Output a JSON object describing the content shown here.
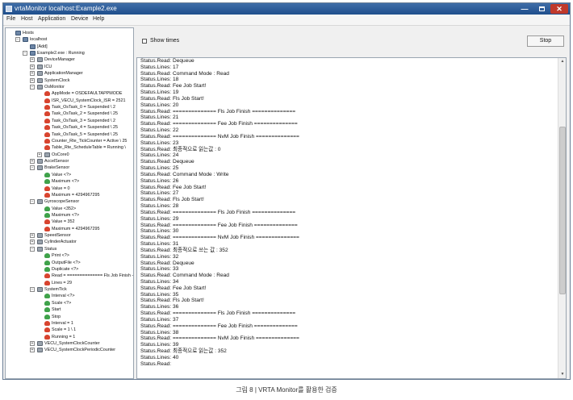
{
  "window": {
    "title": "vrtaMonitor localhost:Example2.exe",
    "min_glyph": "—",
    "close_glyph": "✕"
  },
  "menu": [
    "File",
    "Host",
    "Application",
    "Device",
    "Help"
  ],
  "tree": {
    "rows": [
      {
        "label": "Hosts",
        "depth": 0,
        "icon": "host",
        "toggle": ""
      },
      {
        "label": "localhost",
        "depth": 1,
        "icon": "host",
        "toggle": "−"
      },
      {
        "label": "[Add]",
        "depth": 2,
        "icon": "host",
        "toggle": ""
      },
      {
        "label": "Example2.exe : Running",
        "depth": 2,
        "icon": "app",
        "toggle": "−"
      },
      {
        "label": "DeviceManager",
        "depth": 3,
        "icon": "folder",
        "toggle": "+"
      },
      {
        "label": "ICU",
        "depth": 3,
        "icon": "folder",
        "toggle": "+"
      },
      {
        "label": "ApplicationManager",
        "depth": 3,
        "icon": "folder",
        "toggle": "+"
      },
      {
        "label": "SystemClock",
        "depth": 3,
        "icon": "folder",
        "toggle": "+"
      },
      {
        "label": "OsMonitor",
        "depth": 3,
        "icon": "folder",
        "toggle": "−"
      },
      {
        "label": "AppMode = OSDEFAULTAPPMODE",
        "depth": 4,
        "icon": "person-red",
        "toggle": ""
      },
      {
        "label": "ISR_VECU_SystemClock_ISR = 2521",
        "depth": 4,
        "icon": "person-red",
        "toggle": ""
      },
      {
        "label": "Task_OsTask_0 = Suspended \\ 2",
        "depth": 4,
        "icon": "person-red",
        "toggle": ""
      },
      {
        "label": "Task_OsTask_2 = Suspended \\ 25",
        "depth": 4,
        "icon": "person-red",
        "toggle": ""
      },
      {
        "label": "Task_OsTask_3 = Suspended \\ 2",
        "depth": 4,
        "icon": "person-red",
        "toggle": ""
      },
      {
        "label": "Task_OsTask_4 = Suspended \\ 25",
        "depth": 4,
        "icon": "person-red",
        "toggle": ""
      },
      {
        "label": "Task_OsTask_5 = Suspended \\ 25",
        "depth": 4,
        "icon": "person-red",
        "toggle": ""
      },
      {
        "label": "Counter_Rte_TickCounter = Active \\ 25",
        "depth": 4,
        "icon": "person-red",
        "toggle": ""
      },
      {
        "label": "Table_Rte_ScheduleTable = Running \\",
        "depth": 4,
        "icon": "person-red",
        "toggle": ""
      },
      {
        "label": "OsCore0",
        "depth": 4,
        "icon": "folder",
        "toggle": "+"
      },
      {
        "label": "AccelSensor",
        "depth": 3,
        "icon": "folder",
        "toggle": "+"
      },
      {
        "label": "BrakeSensor",
        "depth": 3,
        "icon": "folder",
        "toggle": "−"
      },
      {
        "label": "Value <?>",
        "depth": 4,
        "icon": "person-green",
        "toggle": ""
      },
      {
        "label": "Maximum <?>",
        "depth": 4,
        "icon": "person-green",
        "toggle": ""
      },
      {
        "label": "Value = 0",
        "depth": 4,
        "icon": "person-red",
        "toggle": ""
      },
      {
        "label": "Maximum = 4294967295",
        "depth": 4,
        "icon": "person-red",
        "toggle": ""
      },
      {
        "label": "GyroscopeSensor",
        "depth": 3,
        "icon": "folder",
        "toggle": "−"
      },
      {
        "label": "Value <352>",
        "depth": 4,
        "icon": "person-green",
        "toggle": ""
      },
      {
        "label": "Maximum <?>",
        "depth": 4,
        "icon": "person-green",
        "toggle": ""
      },
      {
        "label": "Value = 352",
        "depth": 4,
        "icon": "person-red",
        "toggle": ""
      },
      {
        "label": "Maximum = 4294967295",
        "depth": 4,
        "icon": "person-red",
        "toggle": ""
      },
      {
        "label": "SpeedSensor",
        "depth": 3,
        "icon": "folder",
        "toggle": "+"
      },
      {
        "label": "CylinderActuator",
        "depth": 3,
        "icon": "folder",
        "toggle": "+"
      },
      {
        "label": "Status",
        "depth": 3,
        "icon": "folder",
        "toggle": "−"
      },
      {
        "label": "Print <?>",
        "depth": 4,
        "icon": "person-green",
        "toggle": ""
      },
      {
        "label": "OutputFile <?>",
        "depth": 4,
        "icon": "person-green",
        "toggle": ""
      },
      {
        "label": "Duplicate <?>",
        "depth": 4,
        "icon": "person-green",
        "toggle": ""
      },
      {
        "label": "Read = ============== Fls Job Finish -",
        "depth": 4,
        "icon": "person-red",
        "toggle": ""
      },
      {
        "label": "Lines = 29",
        "depth": 4,
        "icon": "person-red",
        "toggle": ""
      },
      {
        "label": "SystemTick",
        "depth": 3,
        "icon": "folder",
        "toggle": "−"
      },
      {
        "label": "Interval <?>",
        "depth": 4,
        "icon": "person-green",
        "toggle": ""
      },
      {
        "label": "Scale <?>",
        "depth": 4,
        "icon": "person-green",
        "toggle": ""
      },
      {
        "label": "Start",
        "depth": 4,
        "icon": "person-green",
        "toggle": ""
      },
      {
        "label": "Stop",
        "depth": 4,
        "icon": "person-green",
        "toggle": ""
      },
      {
        "label": "Interval = 1",
        "depth": 4,
        "icon": "person-red",
        "toggle": ""
      },
      {
        "label": "Scale = 1 \\ 1",
        "depth": 4,
        "icon": "person-red",
        "toggle": ""
      },
      {
        "label": "Running = 1",
        "depth": 4,
        "icon": "person-red",
        "toggle": ""
      },
      {
        "label": "VECU_SystemClockCounter",
        "depth": 3,
        "icon": "folder",
        "toggle": "+"
      },
      {
        "label": "VECU_SystemClockPeriodicCounter",
        "depth": 3,
        "icon": "folder",
        "toggle": "+"
      }
    ]
  },
  "controls": {
    "show_times_label": "Show times",
    "stop_label": "Stop"
  },
  "log": {
    "lines": [
      "Status.Read: Dequeue",
      "Status.Lines: 17",
      "Status.Read: Command Mode : Read",
      "Status.Lines: 18",
      "Status.Read: Fee Job Start!",
      "Status.Lines: 19",
      "Status.Read: Fls Job Start!",
      "Status.Lines: 20",
      "Status.Read: ============== Fls Job Finish ==============",
      "Status.Lines: 21",
      "Status.Read: ============== Fee Job Finish ==============",
      "Status.Lines: 22",
      "Status.Read: ============== NvM Job Finish ==============",
      "Status.Lines: 23",
      "Status.Read: 최종적으로 읽는값 : 0",
      "Status.Lines: 24",
      "Status.Read: Dequeue",
      "Status.Lines: 25",
      "Status.Read: Command Mode : Write",
      "Status.Lines: 26",
      "Status.Read: Fee Job Start!",
      "Status.Lines: 27",
      "Status.Read: Fls Job Start!",
      "Status.Lines: 28",
      "Status.Read: ============== Fls Job Finish ==============",
      "Status.Lines: 29",
      "Status.Read: ============== Fee Job Finish ==============",
      "Status.Lines: 30",
      "Status.Read: ============== NvM Job Finish ==============",
      "Status.Lines: 31",
      "Status.Read: 최종적으로 쓰는 값 : 352",
      "Status.Lines: 32",
      "Status.Read: Dequeue",
      "Status.Lines: 33",
      "Status.Read: Command Mode : Read",
      "Status.Lines: 34",
      "Status.Read: Fee Job Start!",
      "Status.Lines: 35",
      "Status.Read: Fls Job Start!",
      "Status.Lines: 36",
      "Status.Read: ============== Fls Job Finish ==============",
      "Status.Lines: 37",
      "Status.Read: ============== Fee Job Finish ==============",
      "Status.Lines: 38",
      "Status.Read: ============== NvM Job Finish ==============",
      "Status.Lines: 39",
      "Status.Read: 최종적으로 읽는값 : 352",
      "Status.Lines: 40",
      "Status.Read:"
    ]
  },
  "caption": "그림 8 | VRTA Monitor를 활용한 검증"
}
